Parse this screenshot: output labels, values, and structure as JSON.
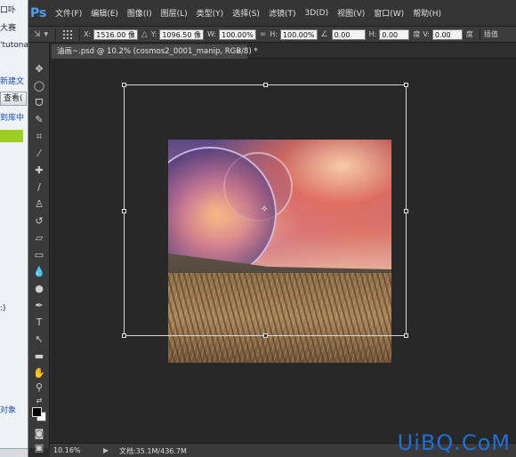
{
  "behind_window": {
    "texts": [
      "口卟",
      "大赛",
      "'tutona",
      "新建文",
      "查看(",
      "到库中",
      ":)",
      "对象"
    ]
  },
  "menubar": {
    "logo": "Ps",
    "items": [
      "文件(F)",
      "编辑(E)",
      "图像(I)",
      "图层(L)",
      "类型(Y)",
      "选择(S)",
      "滤镜(T)",
      "3D(D)",
      "视图(V)",
      "窗口(W)",
      "帮助(H)"
    ]
  },
  "options": {
    "x_label": "X:",
    "x_value": "1516.00 像",
    "y_label": "Y:",
    "y_value": "1096.50 像",
    "w_label": "W:",
    "w_value": "100.00%",
    "h_label": "H:",
    "h_value": "100.00%",
    "angle_value": "0.00",
    "hskew_label": "H:",
    "hskew_value": "0.00",
    "hskew_unit": "度",
    "vskew_label": "V:",
    "vskew_value": "0.00",
    "vskew_unit": "度",
    "interp_label": "插值"
  },
  "document_tab": {
    "title": "油画~.psd @ 10.2% (cosmos2_0001_manip, RGB/8) *",
    "close": "×"
  },
  "statusbar": {
    "zoom": "10.16%",
    "doc_info": "文档:35.1M/436.7M",
    "arrow": "▶"
  },
  "watermark": "UiBQ.CoM"
}
